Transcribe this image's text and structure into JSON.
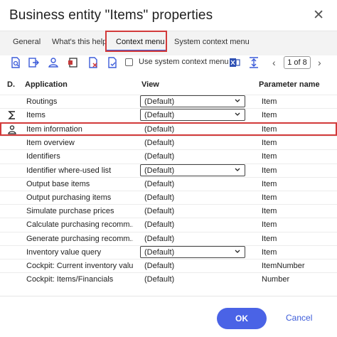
{
  "dialog": {
    "title": "Business entity \"Items\" properties",
    "close_glyph": "✕"
  },
  "tabs": [
    {
      "label": "General"
    },
    {
      "label": "What's this help"
    },
    {
      "label": "Context menu",
      "active": true
    },
    {
      "label": "System context menu"
    }
  ],
  "toolbar": {
    "checkbox_label": "Use system context menu",
    "pager": "1 of 8",
    "icons": [
      "search-doc-icon",
      "export-icon",
      "person-icon",
      "id-card-icon",
      "delete-doc-icon",
      "checked-doc-icon",
      "excel-icon",
      "align-icon"
    ]
  },
  "columns": {
    "d": "D.",
    "application": "Application",
    "view": "View",
    "parameter": "Parameter name"
  },
  "rows": [
    {
      "application": "Routings",
      "view": "(Default)",
      "param": "Item"
    },
    {
      "application": "Items",
      "view": "(Default)",
      "param": "Item"
    },
    {
      "application": "Item information",
      "view": "(Default)",
      "param": "Item"
    },
    {
      "application": "Item overview",
      "view": "(Default)",
      "param": "Item"
    },
    {
      "application": "Identifiers",
      "view": "(Default)",
      "param": "Item"
    },
    {
      "application": "Identifier where-used list",
      "view": "(Default)",
      "param": "Item"
    },
    {
      "application": "Output base items",
      "view": "(Default)",
      "param": "Item"
    },
    {
      "application": "Output purchasing items",
      "view": "(Default)",
      "param": "Item"
    },
    {
      "application": "Simulate purchase prices",
      "view": "(Default)",
      "param": "Item"
    },
    {
      "application": "Calculate purchasing recomm...",
      "view": "(Default)",
      "param": "Item"
    },
    {
      "application": "Generate purchasing recomm...",
      "view": "(Default)",
      "param": "Item"
    },
    {
      "application": "Inventory value query",
      "view": "(Default)",
      "param": "Item"
    },
    {
      "application": "Cockpit: Current inventory valu...",
      "view": "(Default)",
      "param": "ItemNumber"
    },
    {
      "application": "Cockpit: Items/Financials",
      "view": "(Default)",
      "param": "Number"
    }
  ],
  "buttons": {
    "ok": "OK",
    "cancel": "Cancel"
  },
  "colors": {
    "accent": "#4a63e6",
    "highlight": "#d23a3a"
  }
}
